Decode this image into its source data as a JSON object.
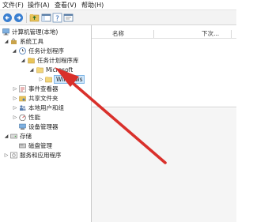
{
  "menu": {
    "file": "文件(F)",
    "action": "操作(A)",
    "view": "查看(V)",
    "help": "帮助(H)"
  },
  "toolbar": {
    "back_icon": "back-arrow-icon",
    "forward_icon": "forward-arrow-icon",
    "up_icon": "up-folder-icon",
    "show_hide_tree_icon": "console-tree-icon",
    "help_icon": "help-icon",
    "properties_icon": "properties-icon"
  },
  "tree": {
    "root": "计算机管理(本地)",
    "system_tools": "系统工具",
    "task_scheduler": "任务计划程序",
    "task_library": "任务计划程序库",
    "microsoft": "Microsoft",
    "windows": "Windows",
    "event_viewer": "事件查看器",
    "shared_folders": "共享文件夹",
    "local_users": "本地用户和组",
    "performance": "性能",
    "device_manager": "设备管理器",
    "storage": "存储",
    "disk_management": "磁盘管理",
    "services_apps": "服务和应用程序"
  },
  "list": {
    "col_name": "名称",
    "col_next_run": "下次..."
  },
  "colors": {
    "selection": "#cfe6fb",
    "arrow": "#d9302b",
    "folder": "#e8c45a"
  }
}
